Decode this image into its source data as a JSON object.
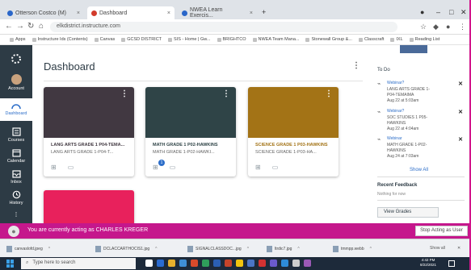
{
  "browser": {
    "tabs": [
      {
        "label": "Otterson Costco (M)"
      },
      {
        "label": "Dashboard"
      },
      {
        "label": "NWEA Learn Exercis..."
      }
    ],
    "new_tab": "+",
    "url": "elkdistrict.instructure.com",
    "bookmarks": [
      "Apps",
      "Instructure Ids (Contents)",
      "Canvas",
      "GCSD DISTRICT",
      "SIS - Home | Gw...",
      "BRIGHTCO",
      "NWEA Team Mana...",
      "Stonewall Group &...",
      "Classcraft",
      "IXL",
      "Reading List"
    ]
  },
  "gnav": {
    "account": "Account",
    "dashboard": "Dashboard",
    "courses": "Courses",
    "calendar": "Calendar",
    "inbox": "Inbox",
    "history": "History"
  },
  "dashboard": {
    "title": "Dashboard",
    "cards": [
      {
        "name": "LANG ARTS GRADE 1 P04-TEMA...",
        "sub": "LANG ARTS GRADE 1-P04-T...",
        "color": "#413841",
        "name_color": "#413841"
      },
      {
        "name": "MATH GRADE 1 P02-HAWKINS",
        "sub": "MATH GRADE 1-P02-HAWKI...",
        "color": "#2f4447",
        "name_color": "#2f4447",
        "badge": "1"
      },
      {
        "name": "SCIENCE GRADE 1 P03-HAWKINS",
        "sub": "SCIENCE GRADE 1-P03-HA...",
        "color": "#a37316",
        "name_color": "#a37316"
      },
      {
        "color": "#e8215c"
      }
    ]
  },
  "todo": {
    "title": "To Do",
    "items": [
      {
        "course": "Webinar?",
        "line1": "LANG ARTS GRADE 1-",
        "line2": "P04-TEMAIMA",
        "due": "Aug 22 at 5:03am"
      },
      {
        "course": "Webinar?",
        "line1": "SOC STUDIES 1 P05-",
        "line2": "HAWKINS",
        "due": "Aug 22 at 4:04am"
      },
      {
        "course": "Webinar",
        "line1": "MATH GRADE 1-P02-",
        "line2": "HAWKINS",
        "due": "Aug 24 at 7:03am"
      }
    ],
    "show_all": "Show All",
    "recent_feedback": "Recent Feedback",
    "nothing": "Nothing for now",
    "view_grades": "View Grades"
  },
  "masquerade": {
    "message": "You are currently acting as CHARLES KREGER",
    "stop_label": "Stop Acting as User"
  },
  "downloads": {
    "files": [
      "canvaslofd.jpeg",
      "DCLACCARTHOCIS1.jpg",
      "SIGNALCLASSDOC...jpg",
      "ltrdic7.jpg",
      "tmmpp.webb"
    ],
    "show_all": "Show all"
  },
  "taskbar": {
    "search_placeholder": "Type here to search",
    "time": "4:42 PM",
    "date": "8/22/2021"
  }
}
